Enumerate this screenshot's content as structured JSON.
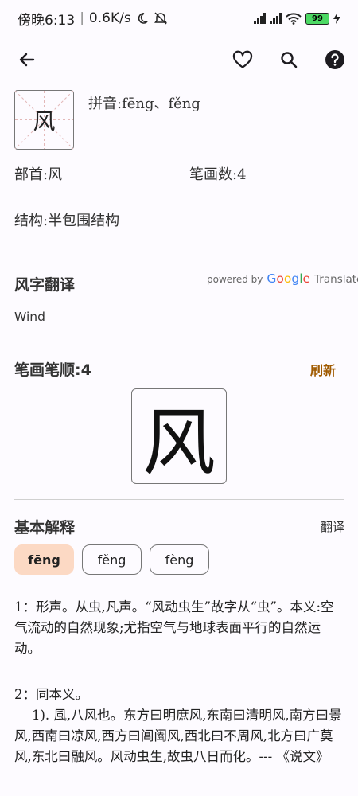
{
  "status": {
    "time": "傍晚6:13",
    "speed": "0.6K/s",
    "battery": "99"
  },
  "character": "风",
  "pinyin_line": "拼音:fēng、fěng",
  "radical_line": "部首:风",
  "strokes_line": "笔画数:4",
  "structure_line": "结构:半包围结构",
  "translate": {
    "title": "风字翻译",
    "powered_by": "powered by",
    "google": [
      "G",
      "o",
      "o",
      "g",
      "l",
      "e"
    ],
    "google_colors": [
      "#4285F4",
      "#EA4335",
      "#FBBC05",
      "#4285F4",
      "#34A853",
      "#EA4335"
    ],
    "translate_word": "Translate",
    "result": "Wind"
  },
  "stroke_order": {
    "title": "笔画笔顺:4",
    "refresh": "刷新"
  },
  "basic": {
    "title": "基本解释",
    "translate": "翻译",
    "chips": [
      "fēng",
      "fěng",
      "fèng"
    ],
    "p1": "1：形声。从虫,凡声。“风动虫生”故字从“虫”。本义:空气流动的自然现象;尤指空气与地球表面平行的自然运动。",
    "p2": "2：同本义。",
    "p3": "1). 風,八风也。东方曰明庶风,东南曰清明风,南方曰景风,西南曰凉风,西方曰阊阖风,西北曰不周风,北方曰广莫风,东北曰融风。风动虫生,故虫八日而化。--- 《说文》"
  }
}
